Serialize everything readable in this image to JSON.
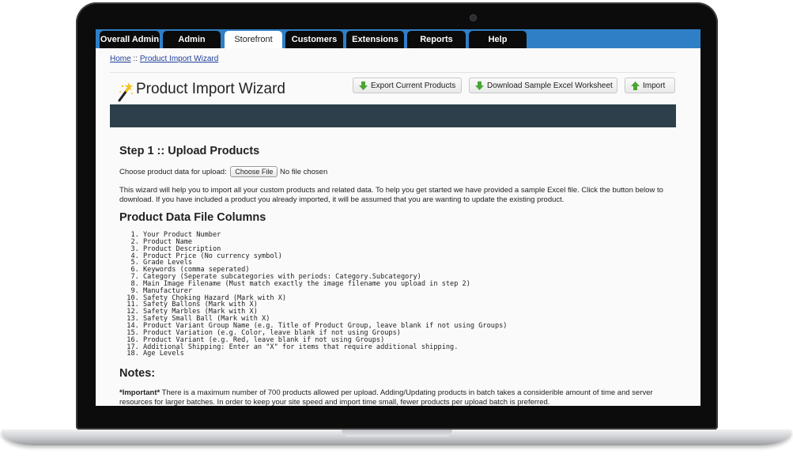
{
  "nav": {
    "tabs": [
      {
        "label": "Overall Admin",
        "active": false
      },
      {
        "label": "Admin",
        "active": false
      },
      {
        "label": "Storefront",
        "active": true
      },
      {
        "label": "Customers",
        "active": false
      },
      {
        "label": "Extensions",
        "active": false
      },
      {
        "label": "Reports",
        "active": false
      },
      {
        "label": "Help",
        "active": false
      }
    ]
  },
  "breadcrumb": {
    "home": "Home",
    "separator": " :: ",
    "current": "Product Import Wizard"
  },
  "page": {
    "title": "Product Import Wizard",
    "buttons": {
      "export": "Export Current Products",
      "download": "Download Sample Excel Worksheet",
      "import": "Import"
    }
  },
  "step1": {
    "heading": "Step 1 :: Upload Products",
    "choose_label": "Choose product data for upload:",
    "file_button": "Choose File",
    "file_status": "No file chosen",
    "description": "This wizard will help you to import all your custom products and related data. To help you get started we have provided a sample Excel file. Click the button below to download. If you have included a product you already imported, it will be assumed that you are wanting to update the existing product."
  },
  "columns": {
    "heading": "Product Data File Columns",
    "items": [
      "Your Product Number",
      "Product Name",
      "Product Description",
      "Product Price (No currency symbol)",
      "Grade Levels",
      "Keywords (comma seperated)",
      "Category (Seperate subcategories with periods: Category.Subcategory)",
      "Main Image Filename (Must match exactly the image filename you upload in step 2)",
      "Manufacturer",
      "Safety Choking Hazard (Mark with X)",
      "Safety Ballons (Mark with X)",
      "Safety Marbles (Mark with X)",
      "Safety Small Ball (Mark with X)",
      "Product Variant Group Name (e.g. Title of Product Group, leave blank if not using Groups)",
      "Product Variation (e.g. Color, leave blank if not using Groups)",
      "Product Variant (e.g. Red, leave blank if not using Groups)",
      "Additional Shipping: Enter an \"X\" for items that require additional shipping.",
      "Age Levels"
    ]
  },
  "notes": {
    "heading": "Notes:",
    "important_label": "*Important*",
    "important_text": " There is a maximum number of 700 products allowed per upload.  Adding/Updating products in batch takes a considerible amount of time and server resources for larger batches.  In order to keep your site speed and import time small, fewer products per upload batch is preferred."
  },
  "colors": {
    "nav_blue": "#2f7fc6",
    "tab_black": "#0b0b0b",
    "header_bar": "#2c3f4a",
    "link_blue": "#1f3f9a",
    "icon_green": "#4aa532"
  }
}
